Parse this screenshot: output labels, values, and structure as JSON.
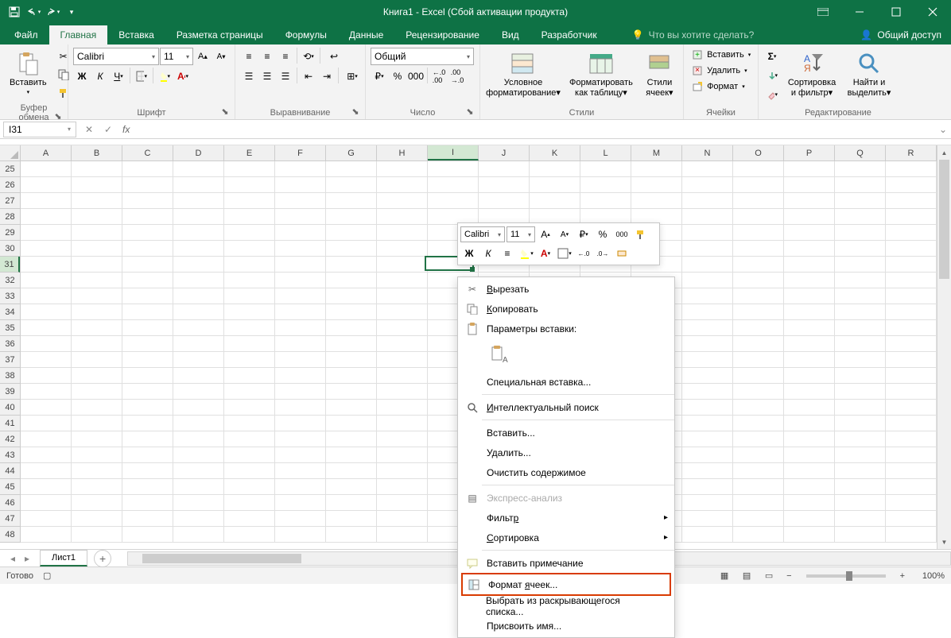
{
  "title": "Книга1 - Excel (Сбой активации продукта)",
  "qat": {
    "save": "save",
    "undo": "undo",
    "redo": "redo"
  },
  "tabs": {
    "file": "Файл",
    "home": "Главная",
    "insert": "Вставка",
    "layout": "Разметка страницы",
    "formulas": "Формулы",
    "data": "Данные",
    "review": "Рецензирование",
    "view": "Вид",
    "developer": "Разработчик"
  },
  "tell_me": "Что вы хотите сделать?",
  "share": "Общий доступ",
  "ribbon": {
    "clipboard": {
      "label": "Буфер обмена",
      "paste": "Вставить"
    },
    "font": {
      "label": "Шрифт",
      "name": "Calibri",
      "size": "11"
    },
    "alignment": {
      "label": "Выравнивание"
    },
    "number": {
      "label": "Число",
      "format": "Общий"
    },
    "styles": {
      "label": "Стили",
      "cond": "Условное форматирование",
      "table": "Форматировать как таблицу",
      "cell": "Стили ячеек"
    },
    "cells": {
      "label": "Ячейки",
      "insert": "Вставить",
      "delete": "Удалить",
      "format": "Формат"
    },
    "editing": {
      "label": "Редактирование",
      "sort": "Сортировка и фильтр",
      "find": "Найти и выделить"
    }
  },
  "name_box": "I31",
  "columns": [
    "A",
    "B",
    "C",
    "D",
    "E",
    "F",
    "G",
    "H",
    "I",
    "J",
    "K",
    "L",
    "M",
    "N",
    "O",
    "P",
    "Q",
    "R"
  ],
  "rows": [
    25,
    26,
    27,
    28,
    29,
    30,
    31,
    32,
    33,
    34,
    35,
    36,
    37,
    38,
    39,
    40,
    41,
    42,
    43,
    44,
    45,
    46,
    47,
    48
  ],
  "selected_col": "I",
  "selected_row": 31,
  "sheet": {
    "name": "Лист1"
  },
  "status": "Готово",
  "zoom": "100%",
  "mini": {
    "font": "Calibri",
    "size": "11"
  },
  "context": {
    "cut": "Вырезать",
    "copy": "Копировать",
    "paste_header": "Параметры вставки:",
    "paste_special": "Специальная вставка...",
    "smart_lookup": "Интеллектуальный поиск",
    "insert": "Вставить...",
    "delete": "Удалить...",
    "clear": "Очистить содержимое",
    "quick_analysis": "Экспресс-анализ",
    "filter": "Фильтр",
    "sort": "Сортировка",
    "comment": "Вставить примечание",
    "format_cells": "Формат ячеек...",
    "dropdown": "Выбрать из раскрывающегося списка...",
    "name": "Присвоить имя..."
  }
}
